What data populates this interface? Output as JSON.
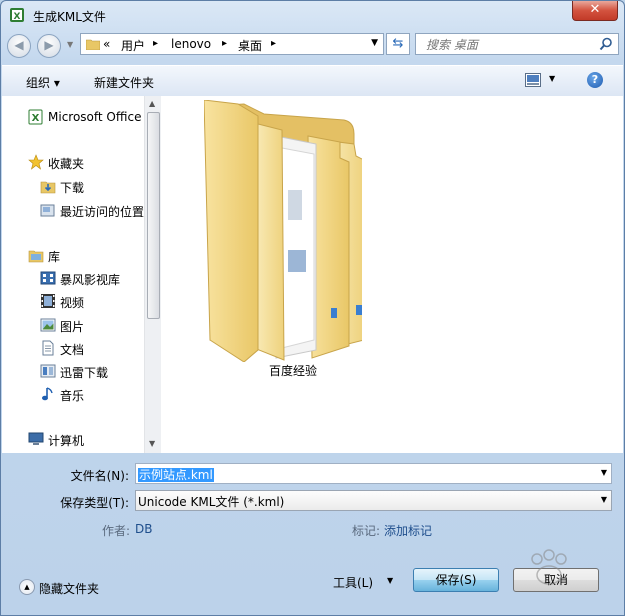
{
  "window": {
    "title": "生成KML文件",
    "close_glyph": "✕"
  },
  "nav": {
    "back_glyph": "◀",
    "forward_glyph": "▶",
    "breadcrumb": [
      "«",
      "用户",
      "▸",
      "lenovo",
      "▸",
      "桌面",
      "▸"
    ],
    "search_placeholder": "搜索 桌面"
  },
  "toolbar": {
    "organize_label": "组织 ▾",
    "new_folder_label": "新建文件夹",
    "help_glyph": "?"
  },
  "sidebar": {
    "items": [
      {
        "label": "Microsoft Office",
        "icon": "excel-icon"
      },
      {
        "label": "收藏夹",
        "icon": "star-icon"
      },
      {
        "label": "下载",
        "icon": "download-folder-icon"
      },
      {
        "label": "最近访问的位置",
        "icon": "recent-places-icon"
      },
      {
        "label": "库",
        "icon": "library-icon"
      },
      {
        "label": "暴风影视库",
        "icon": "video-library-icon"
      },
      {
        "label": "视频",
        "icon": "film-icon"
      },
      {
        "label": "图片",
        "icon": "picture-icon"
      },
      {
        "label": "文档",
        "icon": "document-icon"
      },
      {
        "label": "迅雷下载",
        "icon": "thunder-download-icon"
      },
      {
        "label": "音乐",
        "icon": "music-icon"
      },
      {
        "label": "计算机",
        "icon": "computer-icon"
      }
    ]
  },
  "main": {
    "folder_name": "百度经验"
  },
  "form": {
    "filename_label": "文件名(N):",
    "filename_value": "示例站点.kml",
    "filetype_label": "保存类型(T):",
    "filetype_value": "Unicode KML文件 (*.kml)",
    "author_label": "作者:",
    "author_value": "DB",
    "tags_label": "标记:",
    "tags_value": "添加标记"
  },
  "footer": {
    "hide_folders_label": "隐藏文件夹",
    "tools_label": "工具(L)",
    "save_label": "保存(S)",
    "cancel_label": "取消"
  },
  "colors": {
    "accent": "#3399ff",
    "link": "#1e4e8c",
    "close": "#c23a28"
  }
}
